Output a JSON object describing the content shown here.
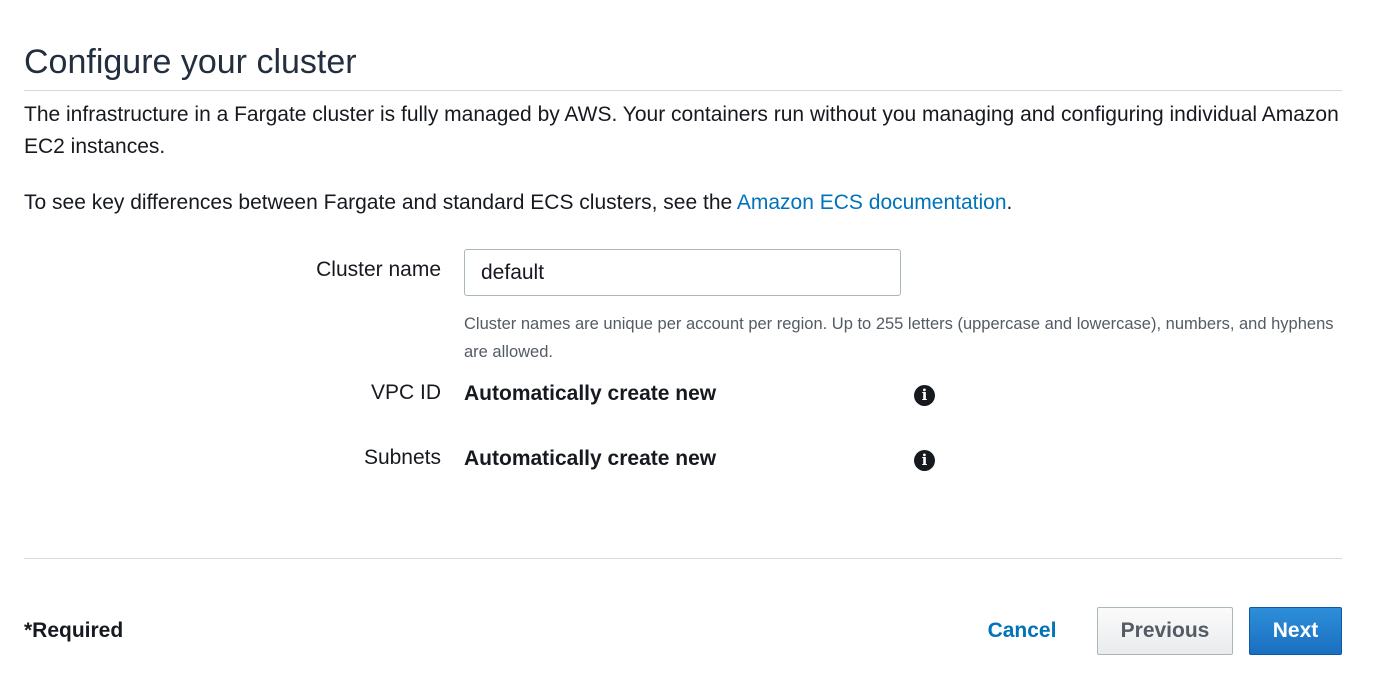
{
  "header": {
    "title": "Configure your cluster"
  },
  "description": {
    "paragraph1": "The infrastructure in a Fargate cluster is fully managed by AWS. Your containers run without you managing and configuring individual Amazon EC2 instances.",
    "paragraph2_prefix": "To see key differences between Fargate and standard ECS clusters, see the ",
    "paragraph2_link": "Amazon ECS documentation",
    "paragraph2_suffix": "."
  },
  "form": {
    "cluster_name": {
      "label": "Cluster name",
      "value": "default",
      "hint": "Cluster names are unique per account per region. Up to 255 letters (uppercase and lowercase), numbers, and hyphens are allowed."
    },
    "vpc_id": {
      "label": "VPC ID",
      "value": "Automatically create new",
      "icon": "info-icon"
    },
    "subnets": {
      "label": "Subnets",
      "value": "Automatically create new",
      "icon": "info-icon"
    }
  },
  "footer": {
    "required_note": "*Required",
    "cancel_label": "Cancel",
    "previous_label": "Previous",
    "next_label": "Next"
  },
  "colors": {
    "link": "#0073bb",
    "primary_button": "#1a6fc0",
    "text": "#16191f"
  }
}
